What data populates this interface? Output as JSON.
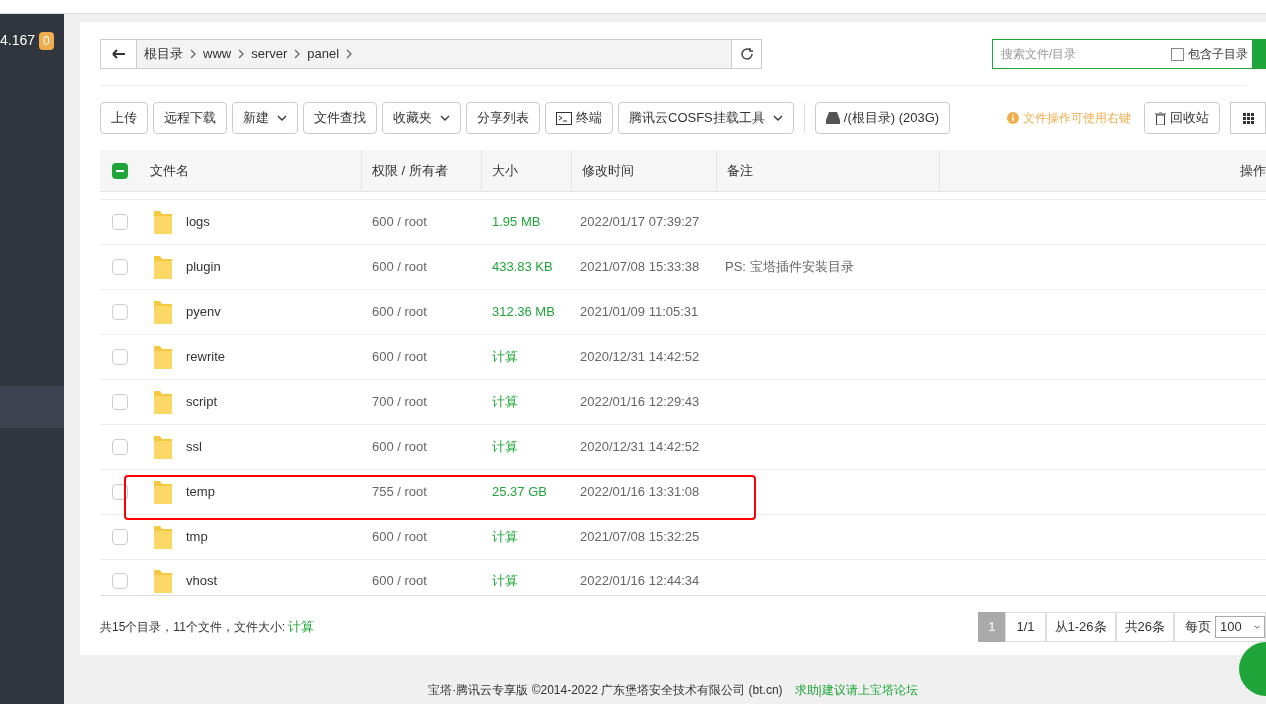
{
  "sidebar": {
    "address": "4.167",
    "badge": "0"
  },
  "path_bar": {
    "crumbs": [
      "根目录",
      "www",
      "server",
      "panel"
    ]
  },
  "search": {
    "placeholder": "搜索文件/目录",
    "include_subdirs": {
      "label": "包含子目录",
      "checked": false
    }
  },
  "toolbar": [
    {
      "kind": "button",
      "label": "上传"
    },
    {
      "kind": "button",
      "label": "远程下载"
    },
    {
      "kind": "dropdown",
      "label": "新建"
    },
    {
      "kind": "button",
      "label": "文件查找"
    },
    {
      "kind": "dropdown",
      "label": "收藏夹"
    },
    {
      "kind": "button",
      "label": "分享列表"
    },
    {
      "kind": "terminal",
      "label": "终端"
    },
    {
      "kind": "dropdown",
      "label": "腾讯云COSFS挂载工具"
    },
    {
      "kind": "disk",
      "label": "/(根目录) (203G)"
    }
  ],
  "hint": "文件操作可使用右键",
  "recycle_bin": "回收站",
  "table": {
    "partially_checked": true,
    "columns": [
      "文件名",
      "权限 / 所有者",
      "大小",
      "修改时间",
      "备注",
      "操作"
    ],
    "rows": [
      {
        "name": "logs",
        "perm": "600 / root",
        "size": "1.95 MB",
        "mtime": "2022/01/17 07:39:27",
        "note": "",
        "checked": false,
        "highlighted": false
      },
      {
        "name": "plugin",
        "perm": "600 / root",
        "size": "433.83 KB",
        "mtime": "2021/07/08 15:33:38",
        "note": "PS: 宝塔插件安装目录",
        "checked": false,
        "highlighted": false
      },
      {
        "name": "pyenv",
        "perm": "600 / root",
        "size": "312.36 MB",
        "mtime": "2021/01/09 11:05:31",
        "note": "",
        "checked": false,
        "highlighted": false
      },
      {
        "name": "rewrite",
        "perm": "600 / root",
        "size": "计算",
        "mtime": "2020/12/31 14:42:52",
        "note": "",
        "checked": false,
        "highlighted": false
      },
      {
        "name": "script",
        "perm": "700 / root",
        "size": "计算",
        "mtime": "2022/01/16 12:29:43",
        "note": "",
        "checked": false,
        "highlighted": false
      },
      {
        "name": "ssl",
        "perm": "600 / root",
        "size": "计算",
        "mtime": "2020/12/31 14:42:52",
        "note": "",
        "checked": false,
        "highlighted": false
      },
      {
        "name": "temp",
        "perm": "755 / root",
        "size": "25.37 GB",
        "mtime": "2022/01/16 13:31:08",
        "note": "",
        "checked": false,
        "highlighted": true
      },
      {
        "name": "tmp",
        "perm": "600 / root",
        "size": "计算",
        "mtime": "2021/07/08 15:32:25",
        "note": "",
        "checked": false,
        "highlighted": false
      },
      {
        "name": "vhost",
        "perm": "600 / root",
        "size": "计算",
        "mtime": "2022/01/16 12:44:34",
        "note": "",
        "checked": false,
        "highlighted": false
      }
    ]
  },
  "summary": {
    "text": "共15个目录，11个文件，文件大小:",
    "link": "计算"
  },
  "pagination": {
    "pages": [
      {
        "label": "1",
        "selected": true
      }
    ],
    "page_count": "1/1",
    "range": "从1-26条",
    "total": "共26条",
    "per_page_label": "每页",
    "per_page": "100"
  },
  "footer": {
    "copyright": "宝塔·腾讯云专享版 ©2014-2022 广东堡塔安全技术有限公司 (bt.cn)",
    "link": "求助|建议请上宝塔论坛"
  }
}
